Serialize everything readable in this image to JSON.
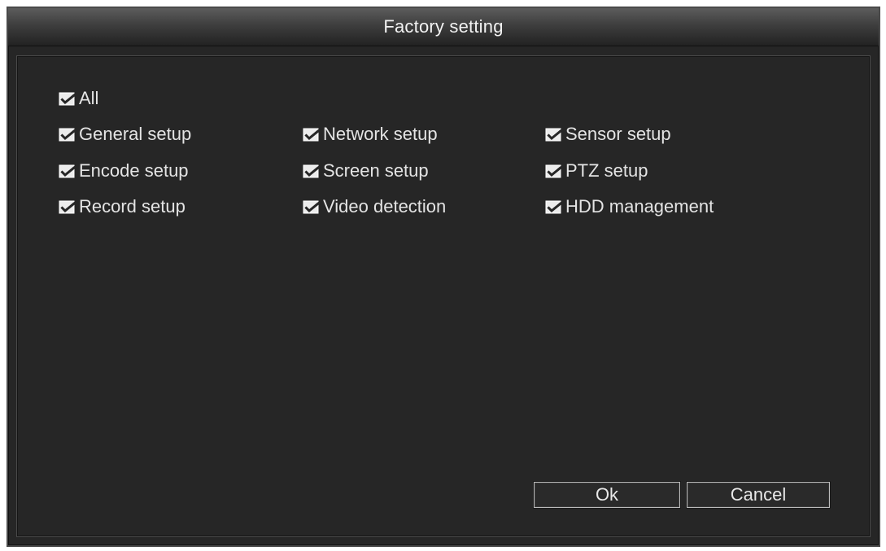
{
  "dialog": {
    "title": "Factory setting",
    "check_icon": "checked-box-icon",
    "all": {
      "label": "All",
      "checked": true
    },
    "rows": [
      [
        {
          "label": "General setup",
          "checked": true
        },
        {
          "label": "Network setup",
          "checked": true
        },
        {
          "label": "Sensor setup",
          "checked": true
        }
      ],
      [
        {
          "label": "Encode setup",
          "checked": true
        },
        {
          "label": "Screen setup",
          "checked": true
        },
        {
          "label": "PTZ setup",
          "checked": true
        }
      ],
      [
        {
          "label": "Record setup",
          "checked": true
        },
        {
          "label": "Video detection",
          "checked": true
        },
        {
          "label": "HDD management",
          "checked": true
        }
      ]
    ],
    "buttons": {
      "ok": "Ok",
      "cancel": "Cancel"
    }
  }
}
